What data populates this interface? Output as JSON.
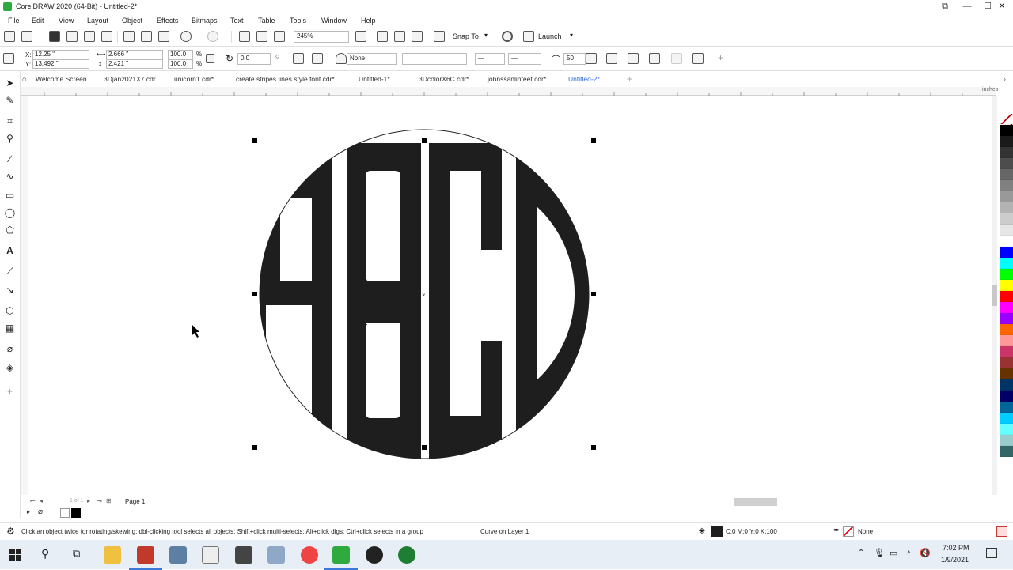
{
  "titlebar": {
    "title": "CorelDRAW 2020 (64-Bit) - Untitled-2*",
    "min": "—",
    "max": "☐",
    "close": "✕",
    "restore": "⧉"
  },
  "menu": [
    "File",
    "Edit",
    "View",
    "Layout",
    "Object",
    "Effects",
    "Bitmaps",
    "Text",
    "Table",
    "Tools",
    "Window",
    "Help"
  ],
  "toolbar": {
    "zoom": "245%",
    "snap_to": "Snap To",
    "launch": "Launch"
  },
  "propbar": {
    "x": "12.25 \"",
    "y": "13.492 \"",
    "w": "2.666 \"",
    "h": "2.421 \"",
    "sx": "100.0",
    "sy": "100.0",
    "pct1": "%",
    "pct2": "%",
    "angle": "0.0",
    "outline": "None",
    "smooth": "50",
    "xlabel": "X:",
    "ylabel": "Y:"
  },
  "tabs": [
    "Welcome Screen",
    "3Djan2021X7.cdr",
    "unicorn1.cdr*",
    "create stripes lines style font.cdr*",
    "Untitled-1*",
    "3DcolorX6C.cdr*",
    "johnssanlinfeet.cdr*",
    "Untitled-2*"
  ],
  "active_tab": "Untitled-2*",
  "ruler": {
    "units": "inches"
  },
  "artwork": {
    "letters": "ABCD"
  },
  "pagenav": {
    "page": "Page 1",
    "count": "1 of 1"
  },
  "status": {
    "hint": "Click an object twice for rotating/skewing; dbl-clicking tool selects all objects; Shift+click multi-selects; Alt+click digs; Ctrl+click selects in a group",
    "object": "Curve on Layer 1",
    "fill": "C:0 M:0 Y:0 K:100",
    "outline": "None"
  },
  "taskbar": {
    "time": "7:02 PM",
    "date": "1/9/2021"
  },
  "palette": [
    "#ffffff",
    "#000000",
    "#1a1a1a",
    "#333333",
    "#4d4d4d",
    "#666666",
    "#808080",
    "#999999",
    "#b3b3b3",
    "#cccccc",
    "#e6e6e6",
    "#ffffff",
    "#0000ff",
    "#00ffff",
    "#00ff00",
    "#ffff00",
    "#ff0000",
    "#ff00ff",
    "#9900ff",
    "#ff6600",
    "#ff9999",
    "#cc3366",
    "#993333",
    "#663300",
    "#003366",
    "#000066",
    "#006699",
    "#00ccff",
    "#66ffff",
    "#99cccc",
    "#336666"
  ],
  "colors": {
    "accent": "#2b6cd6",
    "fill": "#1e1e1e"
  }
}
